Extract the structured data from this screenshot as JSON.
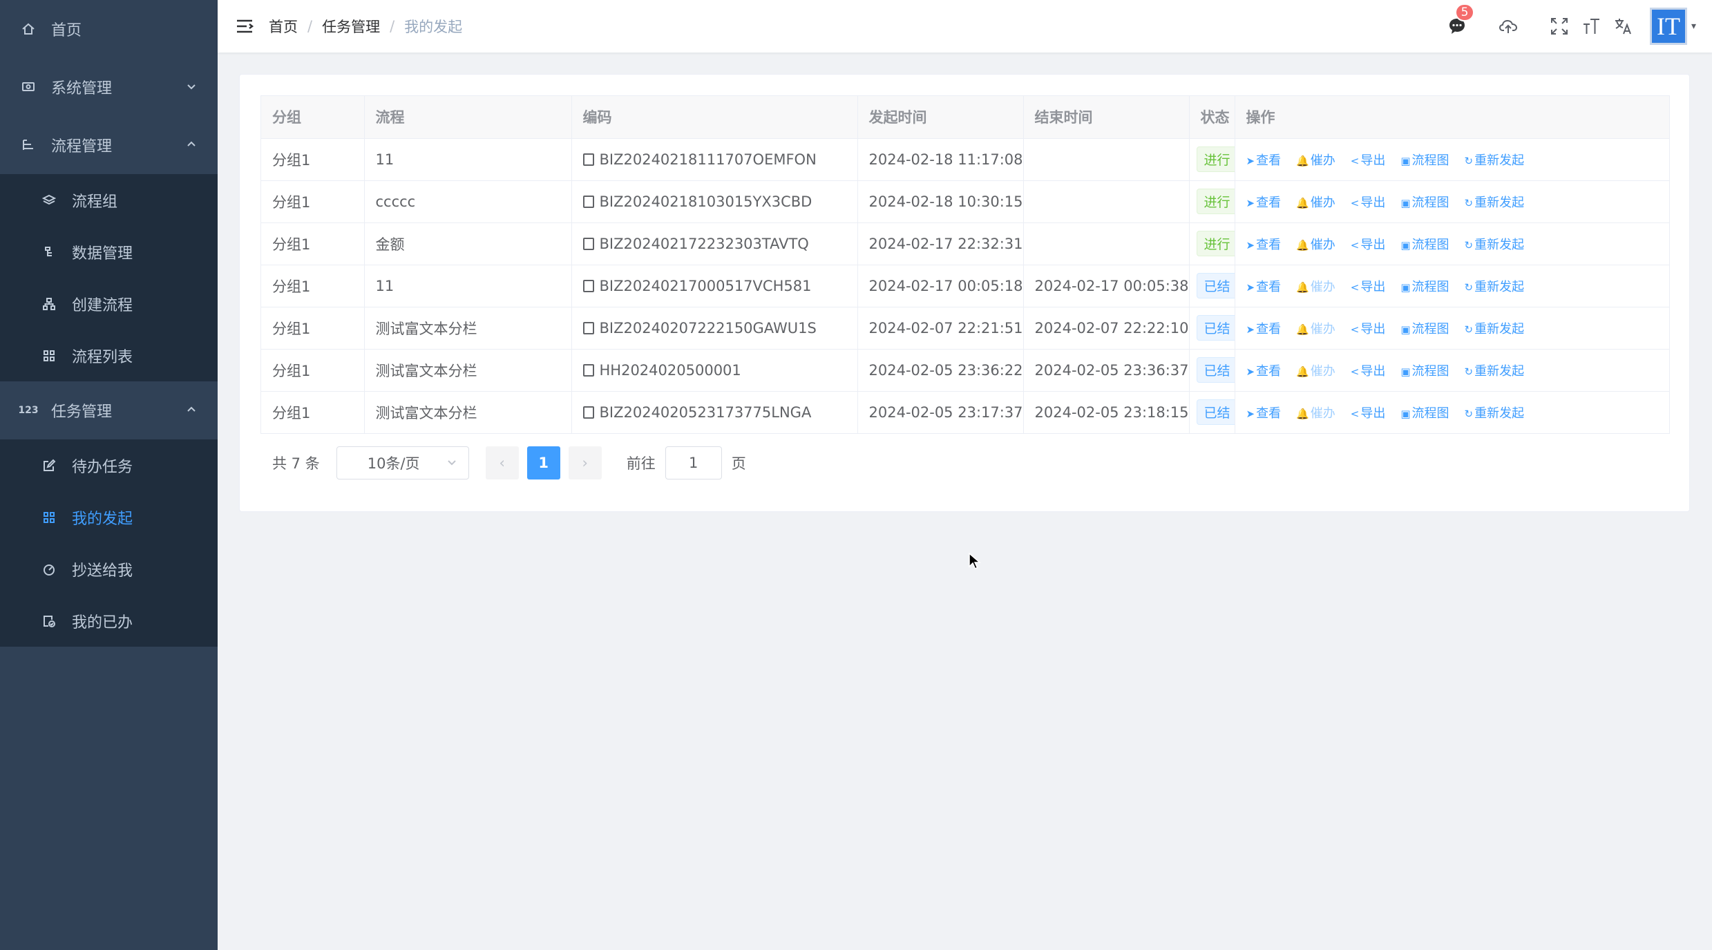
{
  "sidebar": {
    "home": "首页",
    "system": "系统管理",
    "process": "流程管理",
    "process_items": [
      "流程组",
      "数据管理",
      "创建流程",
      "流程列表"
    ],
    "task": "任务管理",
    "task_items": [
      "待办任务",
      "我的发起",
      "抄送给我",
      "我的已办"
    ]
  },
  "breadcrumb": [
    "首页",
    "任务管理",
    "我的发起"
  ],
  "navbar": {
    "message_count": "5",
    "avatar_text": "IT"
  },
  "table": {
    "headers": [
      "分组",
      "流程",
      "编码",
      "发起时间",
      "结束时间",
      "状态",
      "操作"
    ],
    "rows": [
      {
        "group": "分组1",
        "flow": "11",
        "code": "BIZ20240218111707OEMFON",
        "start": "2024-02-18 11:17:08",
        "end": "",
        "status": "进行"
      },
      {
        "group": "分组1",
        "flow": "ccccc",
        "code": "BIZ20240218103015YX3CBD",
        "start": "2024-02-18 10:30:15",
        "end": "",
        "status": "进行"
      },
      {
        "group": "分组1",
        "flow": "金额",
        "code": "BIZ20240217223230​3TAVTQ",
        "start": "2024-02-17 22:32:31",
        "end": "",
        "status": "进行"
      },
      {
        "group": "分组1",
        "flow": "11",
        "code": "BIZ20240217000517VCH581",
        "start": "2024-02-17 00:05:18",
        "end": "2024-02-17 00:05:38",
        "status": "已结"
      },
      {
        "group": "分组1",
        "flow": "测试富文本分栏",
        "code": "BIZ20240207222150GAWU1S",
        "start": "2024-02-07 22:21:51",
        "end": "2024-02-07 22:22:10",
        "status": "已结"
      },
      {
        "group": "分组1",
        "flow": "测试富文本分栏",
        "code": "HH2024020500001",
        "start": "2024-02-05 23:36:22",
        "end": "2024-02-05 23:36:37",
        "status": "已结"
      },
      {
        "group": "分组1",
        "flow": "测试富文本分栏",
        "code": "BIZ20240205231737​75LNGA",
        "start": "2024-02-05 23:17:37",
        "end": "2024-02-05 23:18:15",
        "status": "已结"
      }
    ],
    "actions": [
      "查看",
      "催办",
      "导出",
      "流程图",
      "重新发起"
    ]
  },
  "pagination": {
    "total": "共 7 条",
    "page_size": "10条/页",
    "current": "1",
    "goto_label": "前往",
    "goto_value": "1",
    "goto_suffix": "页"
  }
}
